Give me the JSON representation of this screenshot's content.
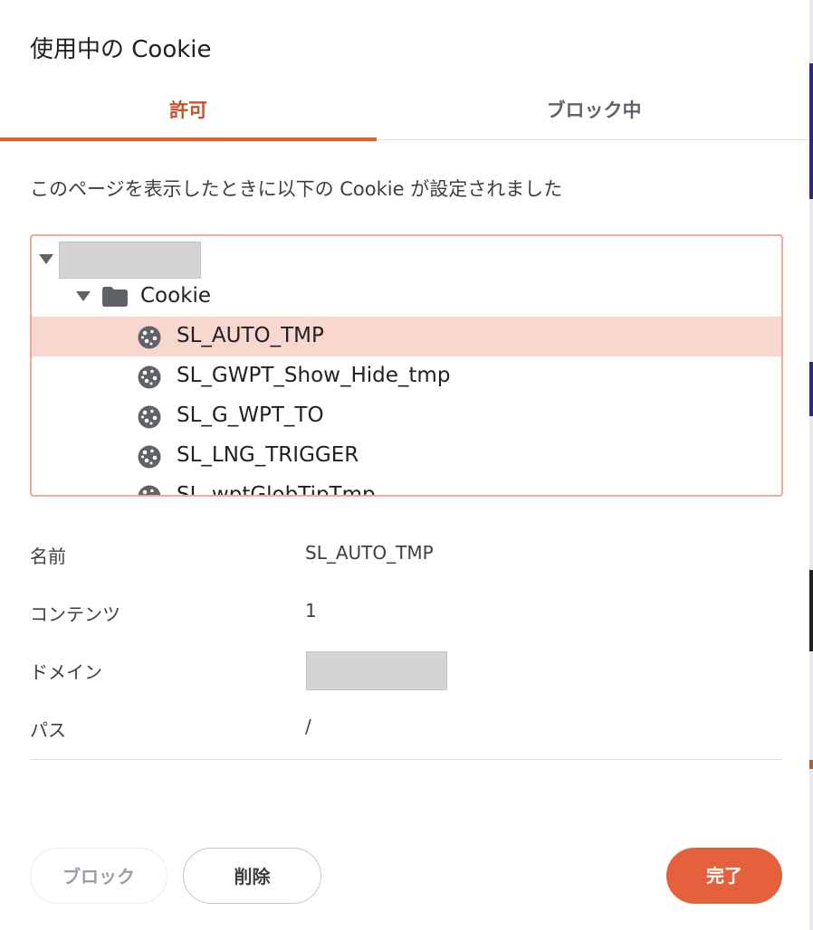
{
  "dialog": {
    "title": "使用中の Cookie",
    "tabs": [
      {
        "label": "許可",
        "active": true
      },
      {
        "label": "ブロック中",
        "active": false
      }
    ],
    "description": "このページを表示したときに以下の Cookie が設定されました",
    "tree": {
      "folder_label": "Cookie",
      "cookies": [
        "SL_AUTO_TMP",
        "SL_GWPT_Show_Hide_tmp",
        "SL_G_WPT_TO",
        "SL_LNG_TRIGGER",
        "SL_wptGlobTipTmp"
      ],
      "selected_index": 0
    },
    "properties": [
      {
        "key": "名前",
        "value": "SL_AUTO_TMP"
      },
      {
        "key": "コンテンツ",
        "value": "1"
      },
      {
        "key": "ドメイン",
        "value": ""
      },
      {
        "key": "パス",
        "value": "/"
      }
    ],
    "buttons": {
      "block": "ブロック",
      "delete": "削除",
      "done": "完了"
    }
  },
  "colors": {
    "accent": "#e0602f",
    "selected_row": "#f8d7cf",
    "done_button": "#e5603c"
  }
}
